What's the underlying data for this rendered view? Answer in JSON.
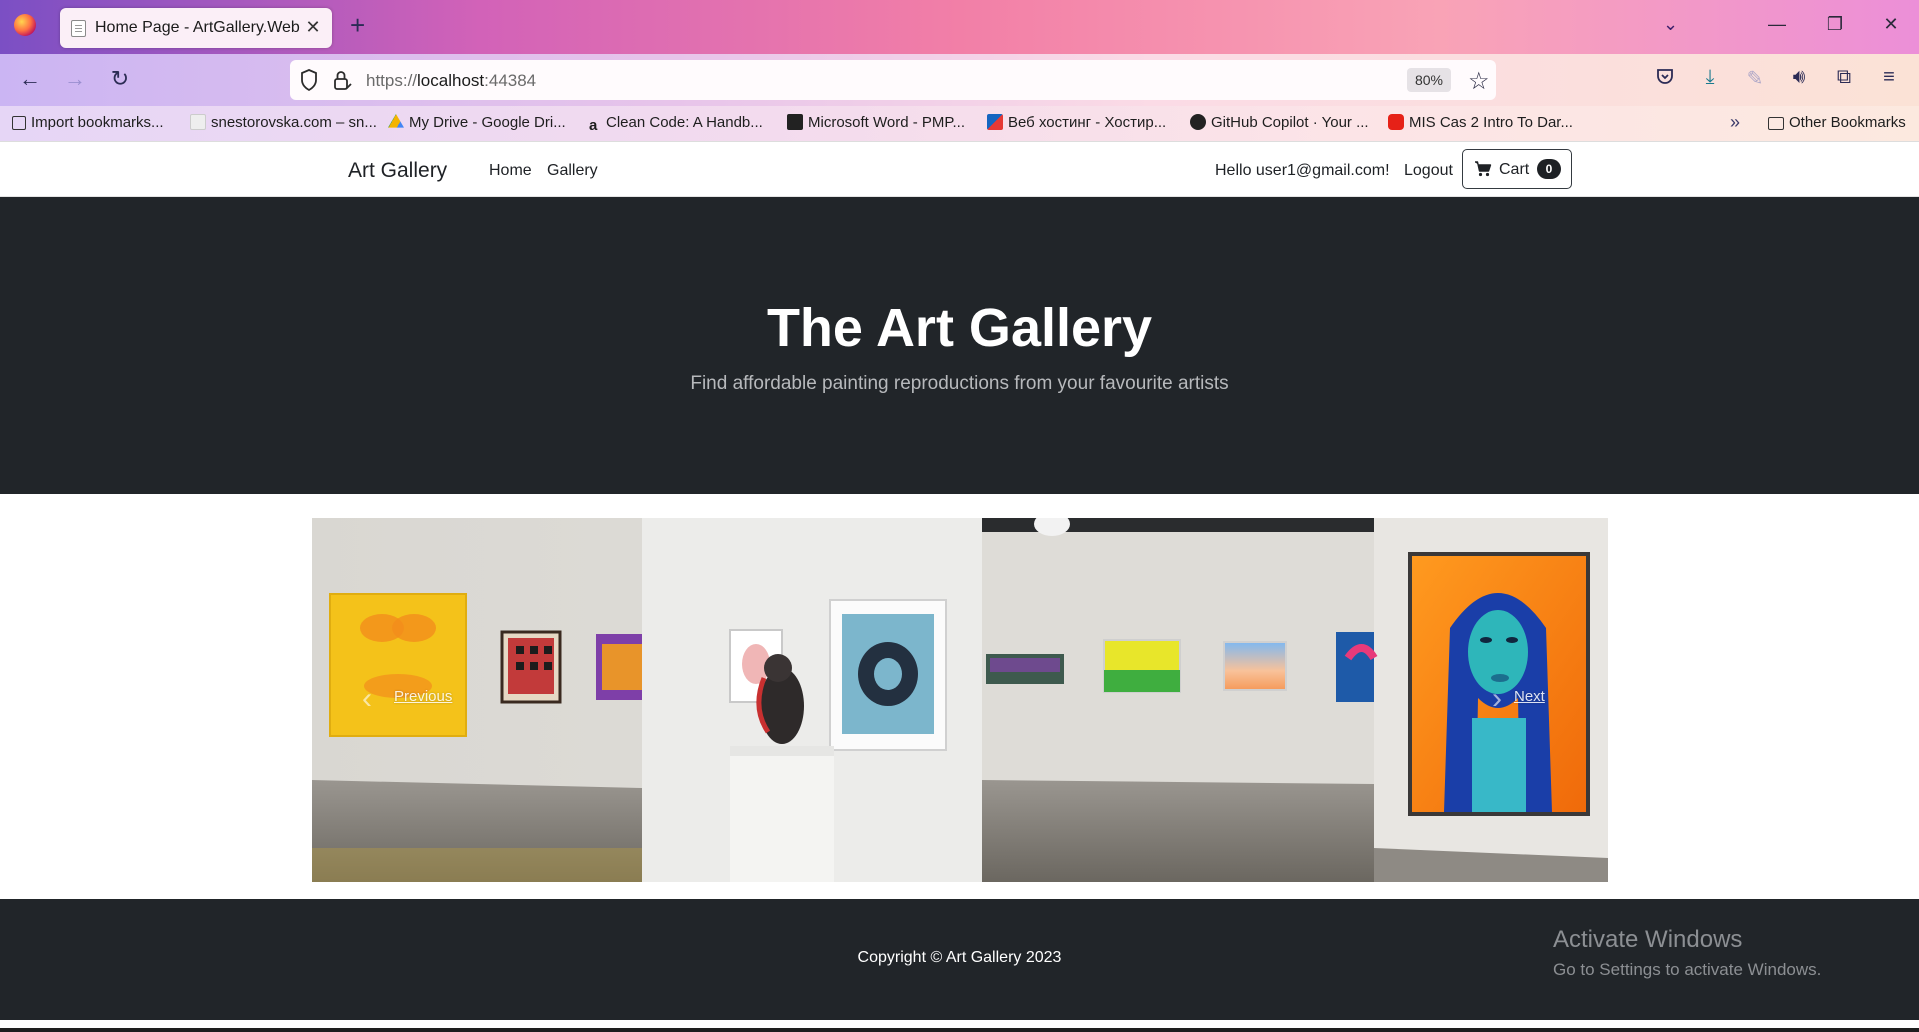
{
  "browser": {
    "tab": {
      "title": "Home Page - ArtGallery.Web",
      "close": "✕"
    },
    "new_tab": "+",
    "url": {
      "scheme": "https://",
      "host": "localhost",
      "port": ":44384"
    },
    "zoom": "80%",
    "bookmarks": [
      {
        "label": "Import bookmarks...",
        "icon": "import-icon"
      },
      {
        "label": "snestorovska.com – sn...",
        "icon": "site-icon"
      },
      {
        "label": "My Drive - Google Dri...",
        "icon": "google-drive-icon"
      },
      {
        "label": "Clean Code: A Handb...",
        "icon": "amazon-icon"
      },
      {
        "label": "Microsoft Word - PMP...",
        "icon": "word-icon"
      },
      {
        "label": "Веб хостинг - Хостир...",
        "icon": "hosting-icon"
      },
      {
        "label": "GitHub Copilot · Your ...",
        "icon": "github-icon"
      },
      {
        "label": "MIS Cas 2 Intro To Dar...",
        "icon": "youtube-icon"
      }
    ],
    "other_bookmarks": "Other Bookmarks",
    "accent_color": "#d262b8"
  },
  "site": {
    "brand": "Art Gallery",
    "nav": [
      "Home",
      "Gallery"
    ],
    "greeting": "Hello user1@gmail.com!",
    "logout": "Logout",
    "cart": {
      "label": "Cart",
      "count": "0"
    },
    "hero": {
      "title": "The Art Gallery",
      "subtitle": "Find affordable painting reproductions from your favourite artists"
    },
    "carousel": {
      "prev": "Previous",
      "next": "Next"
    },
    "footer": {
      "copyright": "Copyright © Art Gallery 2023"
    }
  },
  "os_overlay": {
    "title": "Activate Windows",
    "subtitle": "Go to Settings to activate Windows."
  }
}
